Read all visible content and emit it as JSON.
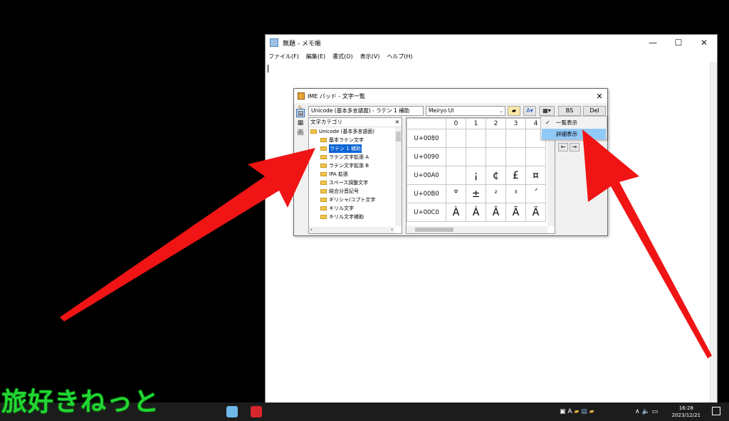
{
  "notepad": {
    "title": "無題 - メモ帳",
    "menu": [
      "ファイル(F)",
      "編集(E)",
      "書式(O)",
      "表示(V)",
      "ヘルプ(H)"
    ],
    "controls": {
      "minimize": "—",
      "maximize": "☐",
      "close": "✕"
    }
  },
  "ime": {
    "title": "IME パッド - 文字一覧",
    "close": "✕",
    "charset": "Unicode (基本多言語面) - ラテン 1 補助",
    "font": "Meiryo UI",
    "bs": "BS",
    "del": "Del",
    "category_header": "文字カテゴリ",
    "category_close": "✕",
    "tree": [
      {
        "label": "Unicode (基本多言語面)",
        "indent": 0,
        "selected": false
      },
      {
        "label": "基本ラテン文字",
        "indent": 1,
        "selected": false
      },
      {
        "label": "ラテン 1 補助",
        "indent": 1,
        "selected": true
      },
      {
        "label": "ラテン文字拡張 A",
        "indent": 1,
        "selected": false
      },
      {
        "label": "ラテン文字拡張 B",
        "indent": 1,
        "selected": false
      },
      {
        "label": "IPA 拡張",
        "indent": 1,
        "selected": false
      },
      {
        "label": "スペース調整文字",
        "indent": 1,
        "selected": false
      },
      {
        "label": "結合分音記号",
        "indent": 1,
        "selected": false
      },
      {
        "label": "ギリシャ/コプト文字",
        "indent": 1,
        "selected": false
      },
      {
        "label": "キリル文字",
        "indent": 1,
        "selected": false
      },
      {
        "label": "キリル文字補助",
        "indent": 1,
        "selected": false
      }
    ],
    "grid_columns": [
      "0",
      "1",
      "2",
      "3",
      "4"
    ],
    "grid_rows": [
      {
        "code": "U+0080",
        "chars": [
          "",
          "",
          "",
          "",
          ""
        ]
      },
      {
        "code": "U+0090",
        "chars": [
          "",
          "",
          "",
          "",
          ""
        ]
      },
      {
        "code": "U+00A0",
        "chars": [
          "",
          "¡",
          "¢",
          "£",
          "¤"
        ]
      },
      {
        "code": "U+00B0",
        "chars": [
          "°",
          "±",
          "²",
          "³",
          "´"
        ]
      },
      {
        "code": "U+00C0",
        "chars": [
          "À",
          "Á",
          "Â",
          "Ã",
          "Ä"
        ]
      }
    ],
    "nav_left": "←",
    "nav_right": "→"
  },
  "view_menu": {
    "items": [
      {
        "label": "一覧表示",
        "checked": true,
        "hover": false
      },
      {
        "label": "詳細表示",
        "checked": false,
        "hover": true
      }
    ]
  },
  "taskbar": {
    "clock_time": "16:28",
    "clock_date": "2023/12/21",
    "ime_indicator": "A"
  },
  "watermark": "旅好きねっと",
  "colors": {
    "arrow": "#f01414",
    "watermark": "#22d633",
    "selection": "#0a64d6",
    "menu_hover": "#91c9f7"
  }
}
